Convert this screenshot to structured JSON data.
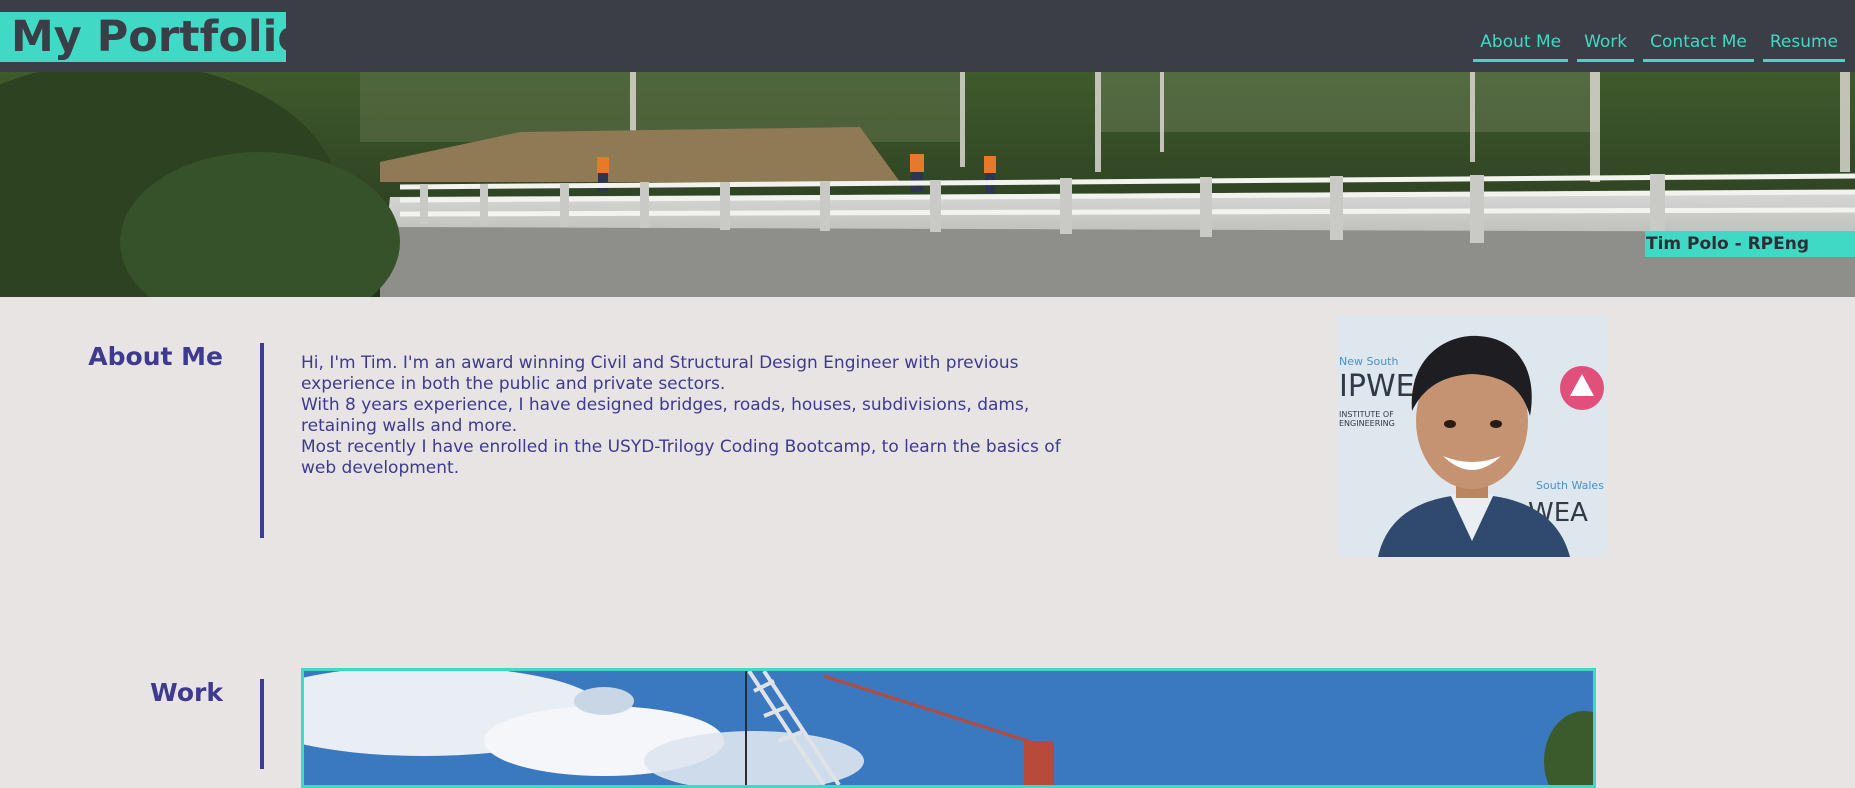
{
  "header": {
    "brand": "My Portfolio",
    "nav": [
      {
        "label": "About Me"
      },
      {
        "label": "Work"
      },
      {
        "label": "Contact Me"
      },
      {
        "label": "Resume"
      }
    ]
  },
  "hero": {
    "tag": "Tim Polo - RPEng"
  },
  "about": {
    "title": "About Me",
    "paragraphs": [
      "Hi, I'm Tim. I'm an award winning Civil and Structural Design Engineer with previous experience in both the public and private sectors.",
      "With 8 years experience, I have designed bridges, roads, houses, subdivisions, dams, retaining walls and more.",
      "Most recently I have enrolled in the USYD-Trilogy Coding Bootcamp, to learn the basics of web development."
    ],
    "portrait_backdrop": {
      "line1": "New South",
      "line2": "IPWE",
      "line3": "INSTITUTE OF",
      "line4": "ENGINEERING",
      "line5": "South Wales",
      "line6": "WEA"
    }
  },
  "work": {
    "title": "Work"
  },
  "colors": {
    "accent": "#40d9c6",
    "header_bg": "#3b3e46",
    "page_bg": "#e8e4e4",
    "heading": "#3e3a8f"
  }
}
